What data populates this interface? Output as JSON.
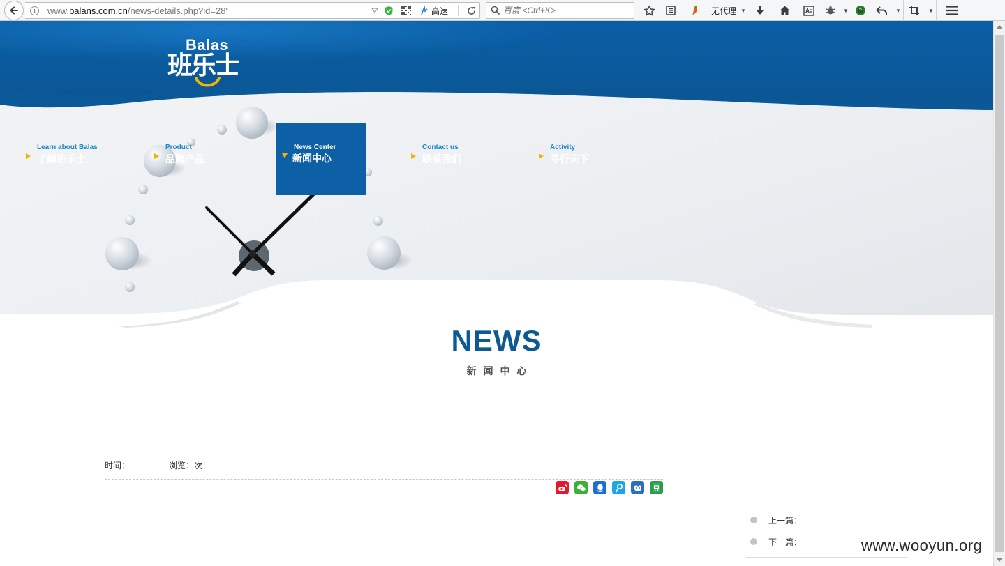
{
  "browser": {
    "url_prefix": "www.",
    "url_domain": "balans.com.cn",
    "url_path": "/news-details.php?id=28'",
    "speed_label": "高速",
    "search_placeholder": "百度 <Ctrl+K>",
    "proxy_label": "无代理"
  },
  "site": {
    "logo_latin": "Balas",
    "logo_cn": "班乐士",
    "accent_blue": "#0d60a6",
    "arrow_color": "#f0b400"
  },
  "nav": [
    {
      "en": "Learn about Balas",
      "cn": "了解班乐士",
      "active": false
    },
    {
      "en": "Product",
      "cn": "品牌产品",
      "active": false
    },
    {
      "en": "News Center",
      "cn": "新闻中心",
      "active": true
    },
    {
      "en": "Contact us",
      "cn": "联系我们",
      "active": false
    },
    {
      "en": "Activity",
      "cn": "寻行天下",
      "active": false
    }
  ],
  "heading": {
    "title": "NEWS",
    "subtitle": "新闻中心"
  },
  "article": {
    "time_label": "时间：",
    "views_label": "浏览：次"
  },
  "share": [
    "weibo-icon",
    "wechat-icon",
    "qq-icon",
    "tencent-weibo-icon",
    "renren-icon",
    "douban-icon"
  ],
  "pager": {
    "prev_label": "上一篇：",
    "next_label": "下一篇："
  },
  "watermark": "www.wooyun.org"
}
